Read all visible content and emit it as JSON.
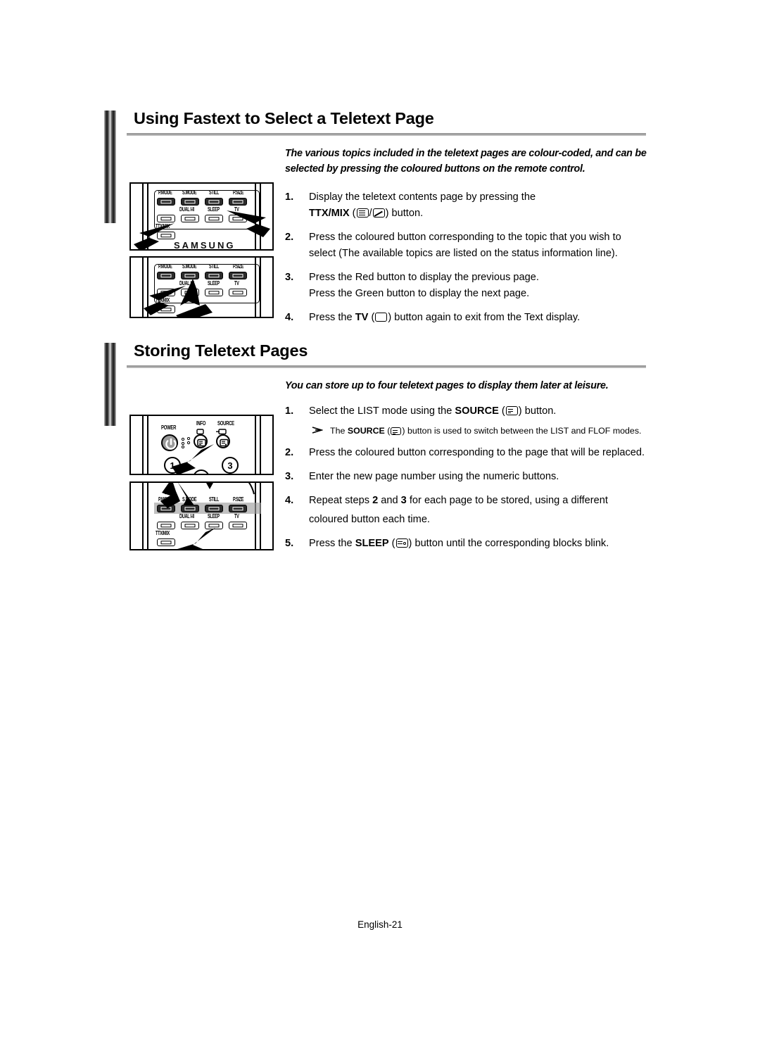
{
  "document": {
    "footer": "English-21"
  },
  "sections": [
    {
      "id": "fastext",
      "title": "Using Fastext to Select a Teletext Page",
      "lead": "The various topics included in the teletext pages are colour-coded, and can be selected by pressing the coloured buttons on the remote control.",
      "steps": [
        {
          "num": "1.",
          "line1_a": "Display the teletext contents page by pressing the",
          "line2_bold": "TTX/MIX",
          "line2_open": "(",
          "line2_sep": "/",
          "line2_close": ")",
          "line2_tail": "button."
        },
        {
          "num": "2.",
          "line1_a": "Press the coloured button corresponding to the topic that you wish to",
          "line2_a": "select (The available topics are listed on the status information line)."
        },
        {
          "num": "3.",
          "line1_a": "Press the Red button to display the previous page.",
          "line2_a": "Press the Green button to display the next page."
        },
        {
          "num": "4.",
          "line1_a": "Press the",
          "line1_bold": "TV",
          "line1_open": "(",
          "line1_close": ")",
          "line1_tail": "button again to exit from the Text display."
        }
      ]
    },
    {
      "id": "storing",
      "title": "Storing Teletext Pages",
      "lead": "You can store up to four teletext pages to display them later at leisure.",
      "steps": [
        {
          "num": "1.",
          "line1_a": "Select the LIST mode using the",
          "line1_bold": "SOURCE",
          "line1_open": "(",
          "line1_close": ")",
          "line1_tail": "button.",
          "note_a": "The",
          "note_bold": "SOURCE",
          "note_open": "(",
          "note_close": ")",
          "note_tail": "button is used to switch between the LIST and FLOF modes."
        },
        {
          "num": "2.",
          "line1_a": "Press the coloured button corresponding to the page that will be replaced."
        },
        {
          "num": "3.",
          "line1_a": "Enter the new page number using the numeric buttons."
        },
        {
          "num": "4.",
          "line1_a": "Repeat steps",
          "line1_b1": "2",
          "line1_mid": "and",
          "line1_b2": "3",
          "line1_tail": "for each page to be stored, using a different",
          "line2_a": "coloured button each time."
        },
        {
          "num": "5.",
          "line1_a": "Press the",
          "line1_bold": "SLEEP",
          "line1_open": "(",
          "line1_close": ")",
          "line1_tail": "button until the corresponding blocks blink."
        }
      ]
    }
  ],
  "remotes": {
    "keys": {
      "pmode": "P.MODE",
      "smode": "S.MODE",
      "still": "STILL",
      "psize": "P.SIZE",
      "dual": "DUAL I-II",
      "sleep": "SLEEP",
      "tv": "TV",
      "ttxmix": "TTX/MIX",
      "power": "POWER",
      "info": "INFO",
      "source": "SOURCE",
      "num1": "1",
      "num3": "3"
    },
    "brand": "SAMSUNG"
  },
  "colors": {
    "ink": "#000000",
    "rule": "#9a9a9a",
    "key_dark": "#2b2b2b",
    "power_gray": "#9a9a9a",
    "highlight": "#9e9e9e"
  }
}
